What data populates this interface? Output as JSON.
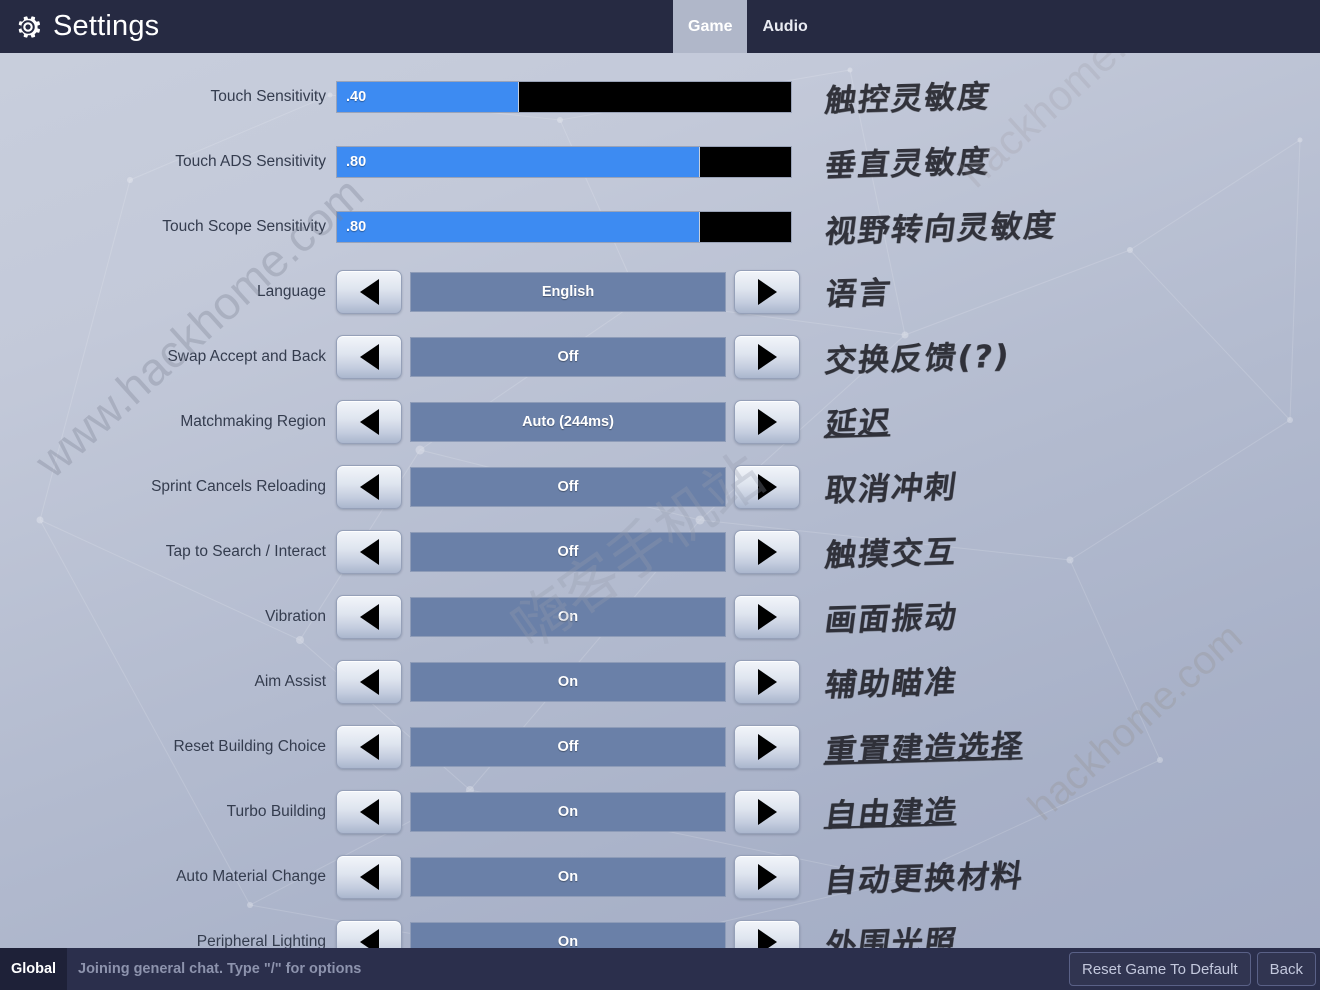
{
  "header": {
    "title": "Settings",
    "gear_icon": "gear-icon",
    "tabs": [
      {
        "label": "Game",
        "selected": true
      },
      {
        "label": "Audio",
        "selected": false
      }
    ]
  },
  "accent": {
    "slider_fill": "#3d8bf2",
    "slider_track": "#000000",
    "value_box": "#6a80a8",
    "header_bg": "#262a42",
    "bottom_bg": "#2b2f4c"
  },
  "settings": [
    {
      "label": "Touch Sensitivity",
      "type": "slider",
      "value": ".40",
      "percent": 40,
      "annotation": "触控灵敏度",
      "annotation_underline": false
    },
    {
      "label": "Touch ADS Sensitivity",
      "type": "slider",
      "value": ".80",
      "percent": 80,
      "annotation": "垂直灵敏度",
      "annotation_underline": false
    },
    {
      "label": "Touch Scope Sensitivity",
      "type": "slider",
      "value": ".80",
      "percent": 80,
      "annotation": "视野转向灵敏度",
      "annotation_underline": false
    },
    {
      "label": "Language",
      "type": "option",
      "value": "English",
      "annotation": "语言",
      "annotation_underline": false
    },
    {
      "label": "Swap Accept and Back",
      "type": "option",
      "value": "Off",
      "annotation": "交换反馈(?)",
      "annotation_underline": false
    },
    {
      "label": "Matchmaking Region",
      "type": "option",
      "value": "Auto (244ms)",
      "annotation": "延迟",
      "annotation_underline": true
    },
    {
      "label": "Sprint Cancels Reloading",
      "type": "option",
      "value": "Off",
      "annotation": "取消冲刺",
      "annotation_underline": false
    },
    {
      "label": "Tap to Search / Interact",
      "type": "option",
      "value": "Off",
      "annotation": "触摸交互",
      "annotation_underline": false
    },
    {
      "label": "Vibration",
      "type": "option",
      "value": "On",
      "annotation": "画面振动",
      "annotation_underline": false
    },
    {
      "label": "Aim Assist",
      "type": "option",
      "value": "On",
      "annotation": "辅助瞄准",
      "annotation_underline": false
    },
    {
      "label": "Reset Building Choice",
      "type": "option",
      "value": "Off",
      "annotation": "重置建造选择",
      "annotation_underline": true
    },
    {
      "label": "Turbo Building",
      "type": "option",
      "value": "On",
      "annotation": "自由建造",
      "annotation_underline": true
    },
    {
      "label": "Auto Material Change",
      "type": "option",
      "value": "On",
      "annotation": "自动更换材料",
      "annotation_underline": false
    },
    {
      "label": "Peripheral Lighting",
      "type": "option",
      "value": "On",
      "annotation": "外围光照",
      "annotation_underline": false
    }
  ],
  "stepper": {
    "prev_icon": "triangle-left-icon",
    "next_icon": "triangle-right-icon"
  },
  "bottom": {
    "chat_channel": "Global",
    "chat_message": "Joining general chat. Type \"/\" for options",
    "buttons": [
      {
        "label": "Reset Game To Default"
      },
      {
        "label": "Back"
      }
    ]
  },
  "watermarks": {
    "left": "www.hackhome.com",
    "right_lower": "hackhome.com",
    "right_upper": "hackhome.com",
    "center_cn": "嗨客手机站"
  }
}
